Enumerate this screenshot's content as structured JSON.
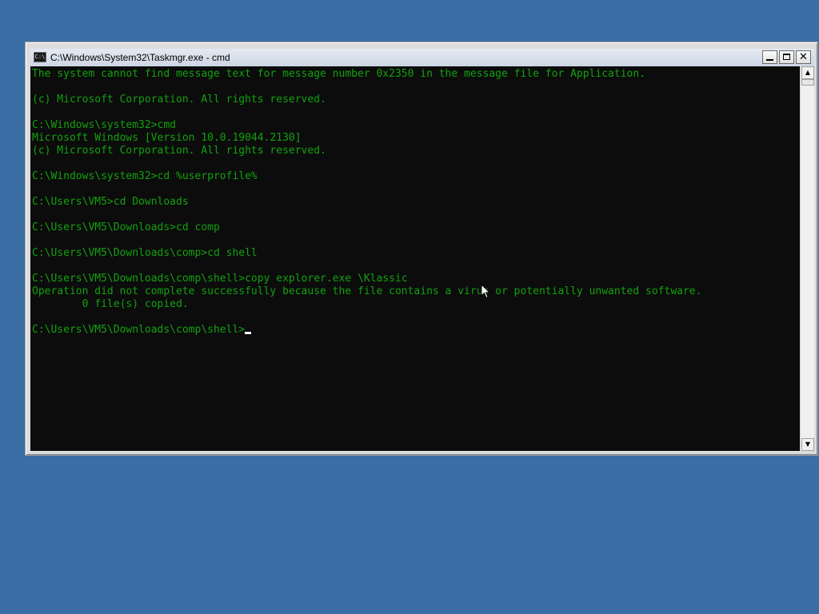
{
  "desktop": {
    "background_color": "#3a6ea5"
  },
  "window": {
    "title": "C:\\Windows\\System32\\Taskmgr.exe - cmd",
    "icon": "console-icon",
    "icon_label": "C:\\",
    "buttons": {
      "minimize": "minimize",
      "maximize": "maximize",
      "close": "close"
    }
  },
  "console": {
    "text_color": "#13a10e",
    "background_color": "#0c0c0c",
    "lines": [
      "The system cannot find message text for message number 0x2350 in the message file for Application.",
      "",
      "(c) Microsoft Corporation. All rights reserved.",
      "",
      "C:\\Windows\\system32>cmd",
      "Microsoft Windows [Version 10.0.19044.2130]",
      "(c) Microsoft Corporation. All rights reserved.",
      "",
      "C:\\Windows\\system32>cd %userprofile%",
      "",
      "C:\\Users\\VM5>cd Downloads",
      "",
      "C:\\Users\\VM5\\Downloads>cd comp",
      "",
      "C:\\Users\\VM5\\Downloads\\comp>cd shell",
      "",
      "C:\\Users\\VM5\\Downloads\\comp\\shell>copy explorer.exe \\Klassic",
      "Operation did not complete successfully because the file contains a virus or potentially unwanted software.",
      "        0 file(s) copied.",
      ""
    ],
    "prompt": "C:\\Users\\VM5\\Downloads\\comp\\shell>"
  },
  "scrollbar": {
    "up_arrow": "▲",
    "down_arrow": "▼"
  }
}
